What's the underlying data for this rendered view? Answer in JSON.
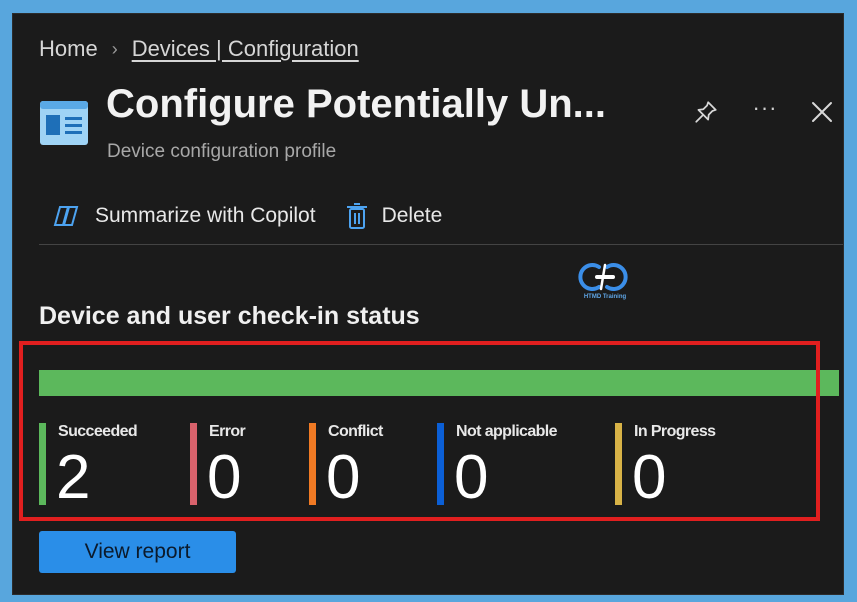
{
  "breadcrumb": {
    "home": "Home",
    "separator": "›",
    "parent": "Devices | Configuration"
  },
  "header": {
    "title": "Configure Potentially Un...",
    "subtitle": "Device configuration profile",
    "icons": {
      "profile": "device-profile-icon",
      "pin": "pin-icon",
      "more": "more-icon",
      "more_glyph": "···",
      "close": "close-icon"
    }
  },
  "toolbar": {
    "summarize_label": "Summarize with Copilot",
    "delete_label": "Delete"
  },
  "logo": {
    "text": "HTMD Training"
  },
  "checkin": {
    "title": "Device and user check-in status",
    "bar_color": "#5cb85c",
    "stats": [
      {
        "label": "Succeeded",
        "value": "2",
        "color": "#5cb85c"
      },
      {
        "label": "Error",
        "value": "0",
        "color": "#d9626c"
      },
      {
        "label": "Conflict",
        "value": "0",
        "color": "#f07a24"
      },
      {
        "label": "Not applicable",
        "value": "0",
        "color": "#0b5fd6"
      },
      {
        "label": "In Progress",
        "value": "0",
        "color": "#d8b347"
      }
    ]
  },
  "actions": {
    "view_report": "View report"
  },
  "colors": {
    "accent": "#2a8ee8",
    "highlight": "#e11f1f",
    "background": "#1b1b1b"
  }
}
